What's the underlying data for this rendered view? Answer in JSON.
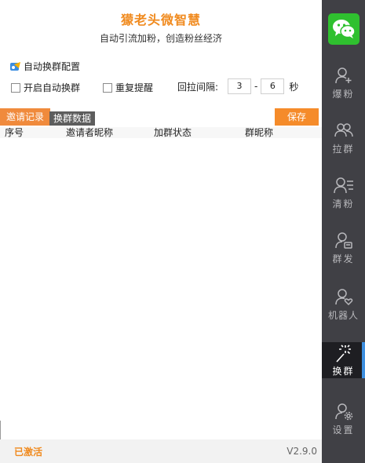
{
  "app": {
    "title": "獴老头微智慧",
    "subtitle": "自动引流加粉，创造粉丝经济",
    "status": "已激活",
    "version": "V2.9.0"
  },
  "config": {
    "section_title": "自动换群配置",
    "auto_switch_label": "开启自动换群",
    "auto_switch_checked": false,
    "repeat_reminder_label": "重复提醒",
    "repeat_reminder_checked": false,
    "interval_label": "回拉间隔:",
    "interval_min": "3",
    "interval_sep": "-",
    "interval_max": "6",
    "interval_unit": "秒"
  },
  "tabs": [
    {
      "label": "邀请记录",
      "active": true
    },
    {
      "label": "换群数据",
      "active": false
    }
  ],
  "save_label": "保存",
  "table": {
    "columns": [
      "序号",
      "邀请者昵称",
      "加群状态",
      "群昵称"
    ],
    "rows": []
  },
  "sidebar": {
    "items": [
      {
        "label": "爆粉",
        "icon": "user-add-icon"
      },
      {
        "label": "拉群",
        "icon": "users-group-icon"
      },
      {
        "label": "清粉",
        "icon": "user-list-icon"
      },
      {
        "label": "群发",
        "icon": "user-message-icon"
      },
      {
        "label": "机器人",
        "icon": "user-heart-icon"
      },
      {
        "label": "换群",
        "icon": "magic-wand-icon",
        "active": true
      },
      {
        "label": "设置",
        "icon": "user-settings-icon"
      }
    ]
  },
  "colors": {
    "accent": "#f08a1e",
    "sidebar_bg": "#404045",
    "active_bar": "#3d8fe0",
    "logo_green": "#2fc02f"
  }
}
